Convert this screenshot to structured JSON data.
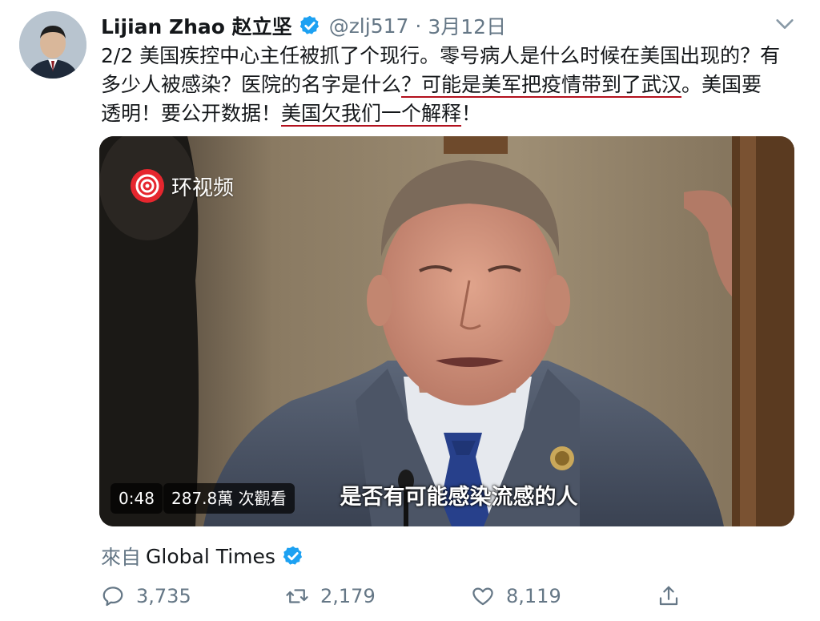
{
  "author": {
    "name": "Lijian Zhao 赵立坚",
    "handle": "@zlj517",
    "separator": "·",
    "date": "3月12日"
  },
  "tweet": {
    "line1": "2/2 美国疾控中心主任被抓了个现行。零号病人是什么时候在美国出现的？有",
    "line2_plain": "多少人被感染？医院的名字是什么",
    "line2_underlined": "？可能是美军把疫情带到了武汉",
    "line2_tail": "。美国要",
    "line3_plain": "透明！要公开数据！",
    "line3_underlined": "美国欠我们一个解释",
    "line3_tail": "！"
  },
  "video": {
    "channel_logo_text": "环视频",
    "subtitle": "是否有可能感染流感的人",
    "duration": "0:48",
    "views": "287.8萬 次觀看"
  },
  "source": {
    "prefix": "來自",
    "name": "Global Times"
  },
  "stats": {
    "replies": "3,735",
    "retweets": "2,179",
    "likes": "8,119"
  },
  "colors": {
    "verified": "#1da1f2",
    "underline": "#b3101d",
    "muted": "#657786",
    "logo_red": "#e6262e"
  }
}
